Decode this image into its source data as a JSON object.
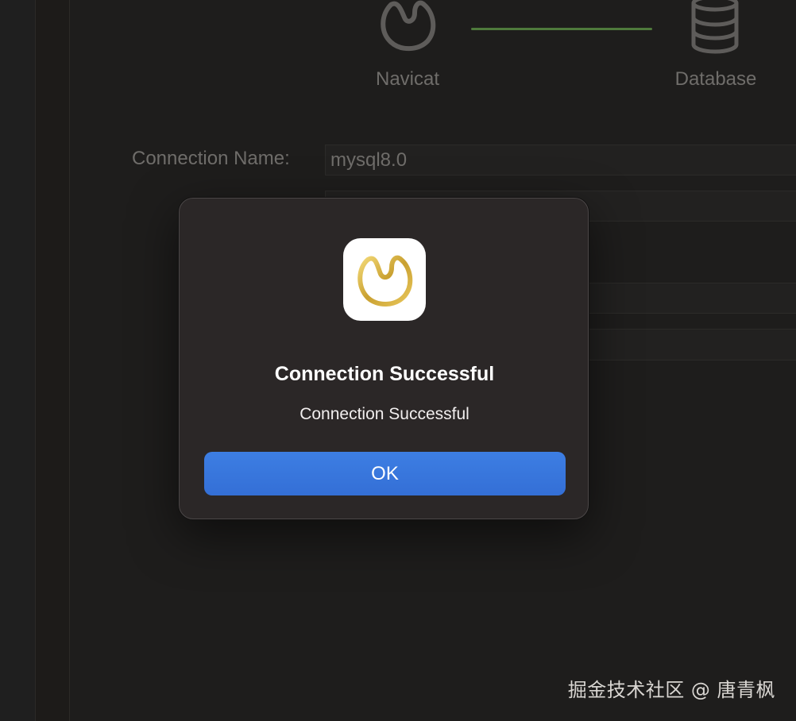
{
  "wizard": {
    "steps": [
      {
        "label": "Navicat",
        "icon": "navicat-icon"
      },
      {
        "label": "Database",
        "icon": "database-icon"
      }
    ],
    "progress_color": "#4f7a3c"
  },
  "form": {
    "connection_name_label": "Connection Name:",
    "connection_name_value": "mysql8.0"
  },
  "dialog": {
    "icon": "navicat-app-icon",
    "title": "Connection Successful",
    "message": "Connection Successful",
    "ok_label": "OK",
    "accent_color": "#3a78df"
  },
  "watermark": {
    "text": "掘金技术社区 @ 唐青枫"
  }
}
